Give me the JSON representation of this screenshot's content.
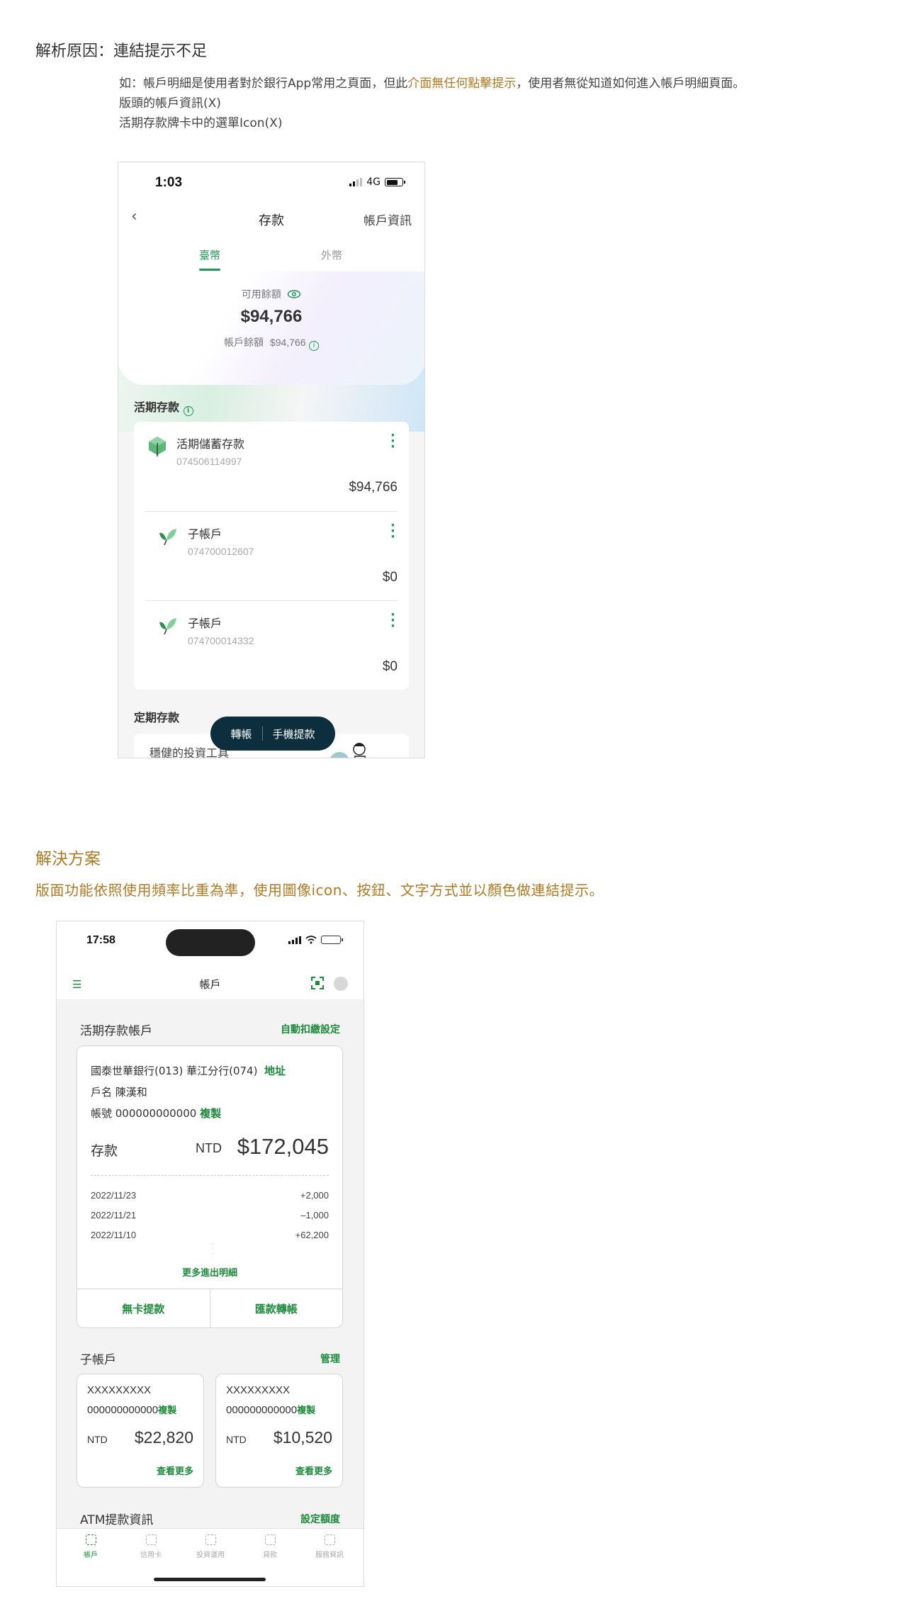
{
  "analysis": {
    "title": "解析原因：連結提示不足",
    "desc_prefix": "如：帳戶明細是使用者對於銀行App常用之頁面，但此",
    "desc_highlight": "介面無任何點擊提示",
    "desc_suffix": "，使用者無從知道如何進入帳戶明細頁面。",
    "point1": "版頭的帳戶資訊(X)",
    "point2": "活期存款牌卡中的選單Icon(X)"
  },
  "old_phone": {
    "time": "1:03",
    "network": "4G",
    "title": "存款",
    "account_info": "帳戶資訊",
    "tabs": [
      "臺幣",
      "外幣"
    ],
    "available_label": "可用餘額",
    "available_amount": "$94,766",
    "balance_label": "帳戶餘額",
    "balance_amount": "$94,766",
    "demand_section": "活期存款",
    "accounts": [
      {
        "name": "活期儲蓄存款",
        "number": "074506114997",
        "amount": "$94,766"
      },
      {
        "name": "子帳戶",
        "number": "074700012607",
        "amount": "$0"
      },
      {
        "name": "子帳戶",
        "number": "074700014332",
        "amount": "$0"
      }
    ],
    "fixed_section": "定期存款",
    "fixed_card_text": "穩健的投資工具",
    "fab": [
      "轉帳",
      "手機提款"
    ]
  },
  "solution": {
    "title": "解決方案",
    "subtitle": "版面功能依照使用頻率比重為準，使用圖像icon、按鈕、文字方式並以顏色做連結提示。"
  },
  "new_phone": {
    "time": "17:58",
    "title": "帳戶",
    "demand_section": "活期存款帳戶",
    "auto_debit": "自動扣繳設定",
    "bank_line": "國泰世華銀行(013) 華江分行(074)",
    "address_link": "地址",
    "holder_line": "戶名 陳漢和",
    "account_line": "帳號 000000000000",
    "copy_link": "複製",
    "deposit_label": "存款",
    "currency": "NTD",
    "deposit_amount": "$172,045",
    "transactions": [
      {
        "date": "2022/11/23",
        "amount": "+2,000"
      },
      {
        "date": "2022/11/21",
        "amount": "–1,000"
      },
      {
        "date": "2022/11/10",
        "amount": "+62,200"
      }
    ],
    "more_details": "更多進出明細",
    "btn_cardless": "無卡提款",
    "btn_transfer": "匯款轉帳",
    "sub_section": "子帳戶",
    "manage": "管理",
    "sub_accounts": [
      {
        "name": "XXXXXXXXX",
        "number": "000000000000",
        "copy": "複製",
        "currency": "NTD",
        "amount": "$22,820",
        "more": "查看更多"
      },
      {
        "name": "XXXXXXXXX",
        "number": "000000000000",
        "copy": "複製",
        "currency": "NTD",
        "amount": "$10,520",
        "more": "查看更多"
      }
    ],
    "atm_section": "ATM提款資訊",
    "set_limit": "設定額度",
    "tabbar": [
      "帳戶",
      "信用卡",
      "投資運用",
      "貸款",
      "服務資訊"
    ]
  }
}
